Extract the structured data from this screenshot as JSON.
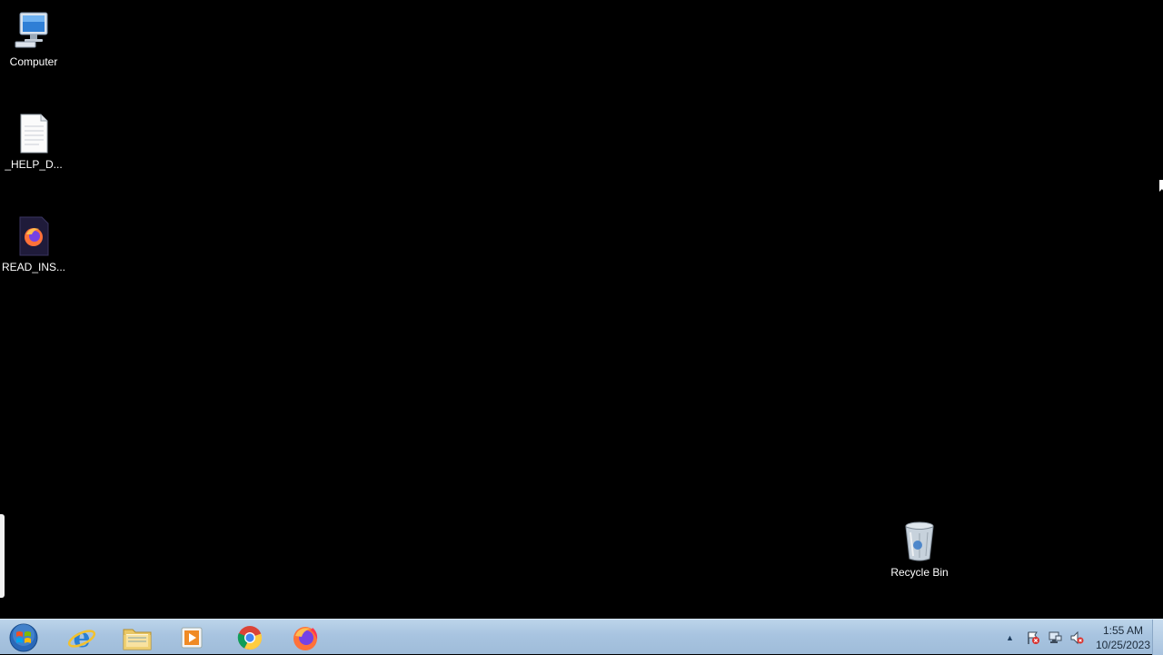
{
  "desktop": {
    "icons": [
      {
        "label": "Computer",
        "icon": "computer-icon"
      },
      {
        "label": "_HELP_D...",
        "icon": "text-document-icon"
      },
      {
        "label": "READ_INS...",
        "icon": "firefox-document-icon"
      },
      {
        "label": "Recycle Bin",
        "icon": "recycle-bin-icon"
      }
    ]
  },
  "taskbar": {
    "start": {
      "icon": "windows-start-orb-icon"
    },
    "pinned": [
      {
        "name": "Internet Explorer",
        "icon": "internet-explorer-icon"
      },
      {
        "name": "Windows Explorer",
        "icon": "folder-icon"
      },
      {
        "name": "Windows Media Player",
        "icon": "media-player-icon"
      },
      {
        "name": "Google Chrome",
        "icon": "chrome-icon"
      },
      {
        "name": "Mozilla Firefox",
        "icon": "firefox-icon"
      }
    ],
    "tray": {
      "icons": [
        "show-hidden-icons-arrow",
        "action-center-flag-icon",
        "network-icon",
        "volume-muted-icon"
      ],
      "time": "1:55 AM",
      "date": "10/25/2023"
    }
  },
  "colors": {
    "desktop_bg": "#000000",
    "taskbar_bg": "#a8c4e0",
    "label_text": "#ffffff"
  }
}
